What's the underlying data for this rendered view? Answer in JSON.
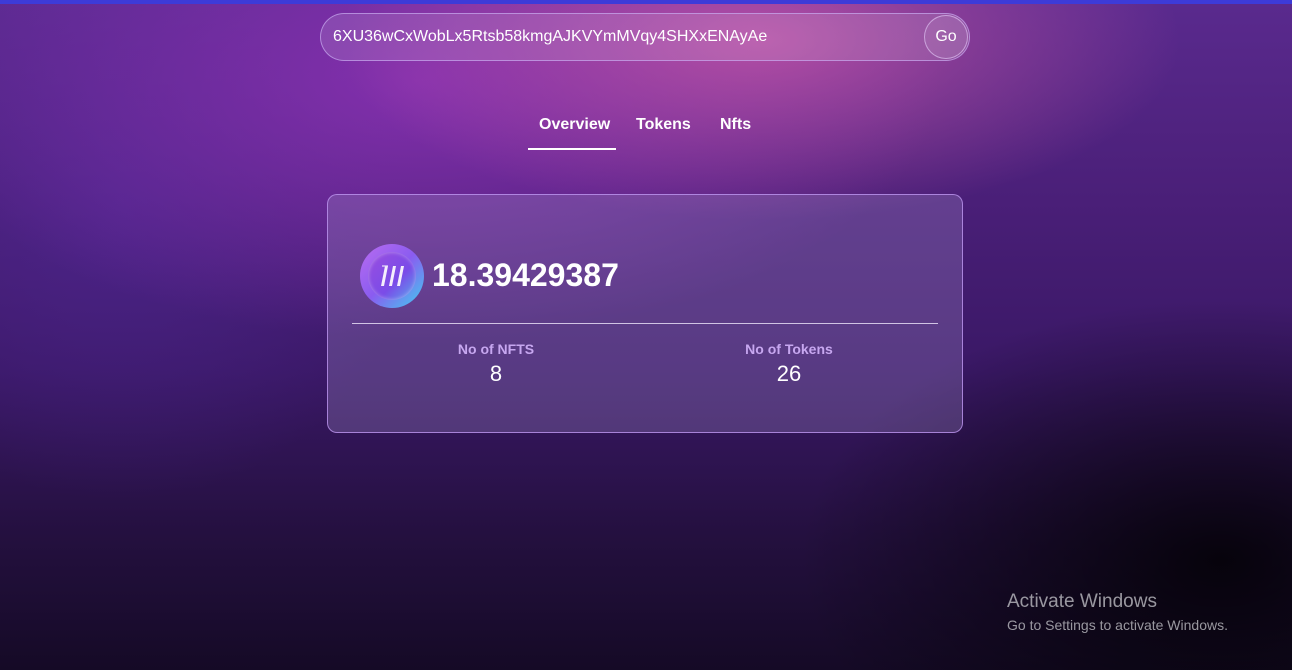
{
  "search": {
    "value": "6XU36wCxWobLx5Rtsb58kmgAJKVYmMVqy4SHXxENAyAe",
    "go_label": "Go"
  },
  "tabs": [
    {
      "label": "Overview",
      "active": true
    },
    {
      "label": "Tokens",
      "active": false
    },
    {
      "label": "Nfts",
      "active": false
    }
  ],
  "overview": {
    "token_icon": "coin-logo-icon",
    "balance": "18.39429387",
    "nfts_label": "No of NFTS",
    "nfts_count": "8",
    "tokens_label": "No of Tokens",
    "tokens_count": "26"
  },
  "watermark": {
    "title": "Activate Windows",
    "subtitle": "Go to Settings to activate Windows."
  },
  "colors": {
    "accent_bar": "#3d3bd8",
    "stat_label": "#c7a7f0"
  }
}
